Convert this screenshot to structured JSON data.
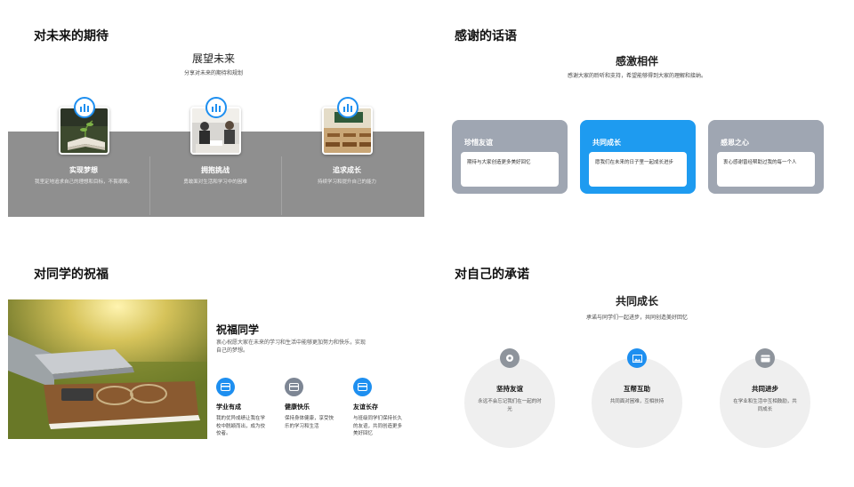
{
  "panel_future": {
    "title": "对未来的期待",
    "subtitle": "展望未来",
    "description": "分享对未来的期待和规划",
    "items": [
      {
        "label": "实现梦想",
        "text": "我坚定地追求自己的理想和目标，不畏艰难。",
        "icon": "chart-icon"
      },
      {
        "label": "拥抱挑战",
        "text": "勇敢面对生活和学习中的困难",
        "icon": "chart-icon"
      },
      {
        "label": "追求成长",
        "text": "持续学习和提升自己的能力",
        "icon": "chart-icon"
      }
    ]
  },
  "panel_thanks": {
    "title": "感谢的话语",
    "subtitle": "感激相伴",
    "description": "感谢大家的聆听和支持，希望能够得到大家的理解和接纳。",
    "cards": [
      {
        "title": "珍惜友谊",
        "text": "期待与大家创造更多美好回忆",
        "active": false
      },
      {
        "title": "共同成长",
        "text": "愿我们在未来的日子里一起成长进步",
        "active": true
      },
      {
        "title": "感恩之心",
        "text": "衷心感谢曾经帮助过我的每一个人",
        "active": false
      }
    ],
    "colors": {
      "card": "#9fa6b2",
      "active": "#1e9bf0"
    }
  },
  "panel_wishes": {
    "title": "对同学的祝福",
    "heading": "祝福同学",
    "description": "衷心祝愿大家在未来的学习和生活中能够更加努力和快乐，实现自己的梦想。",
    "items": [
      {
        "label": "学业有成",
        "text": "我的优异成绩让我在学校中脱颖而出，成为佼佼者。",
        "icon": "card-icon",
        "color": "#1e8ff0"
      },
      {
        "label": "健康快乐",
        "text": "保持身体健康，享受快乐的学习和生活",
        "icon": "card-icon",
        "color": "#7d8694"
      },
      {
        "label": "友谊长存",
        "text": "与班级同学们保持长久的友谊，共同创造更多美好回忆",
        "icon": "card-icon",
        "color": "#1e8ff0"
      }
    ]
  },
  "panel_promise": {
    "title": "对自己的承诺",
    "subtitle": "共同成长",
    "description": "承诺与同学们一起进步，共同创造美好回忆",
    "items": [
      {
        "label": "坚持友谊",
        "text": "永远不会忘记我们在一起的时光",
        "icon": "location-pin-icon",
        "color": "#8e949c"
      },
      {
        "label": "互帮互助",
        "text": "共同面对困难，互相扶持",
        "icon": "image-icon",
        "color": "#1e8ff0"
      },
      {
        "label": "共同进步",
        "text": "在学业和生活中互相鼓励，共同成长",
        "icon": "wallet-icon",
        "color": "#8e949c"
      }
    ]
  }
}
